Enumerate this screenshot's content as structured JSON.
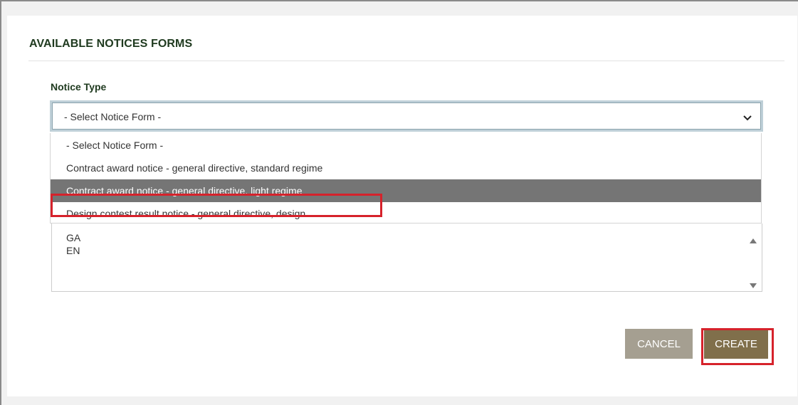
{
  "dialog": {
    "title": "AVAILABLE NOTICES FORMS"
  },
  "notice_type": {
    "label": "Notice Type",
    "selected_value": "- Select Notice Form -",
    "chevron_icon": "chevron-down-icon",
    "options": [
      {
        "label": "- Select Notice Form -",
        "highlighted": false
      },
      {
        "label": "Contract award notice - general directive, standard regime",
        "highlighted": false
      },
      {
        "label": "Contract award notice - general directive, light regime",
        "highlighted": true
      },
      {
        "label": "Design contest result notice - general directive, design",
        "highlighted": false
      }
    ]
  },
  "languages": {
    "items": [
      "GA",
      "EN"
    ]
  },
  "actions": {
    "cancel_label": "CANCEL",
    "create_label": "CREATE"
  },
  "colors": {
    "heading": "#1f3a1f",
    "selected_option_bg": "#757575",
    "cancel_button": "#a59f91",
    "create_button": "#806f4b",
    "annotation_highlight": "#d6222b"
  }
}
